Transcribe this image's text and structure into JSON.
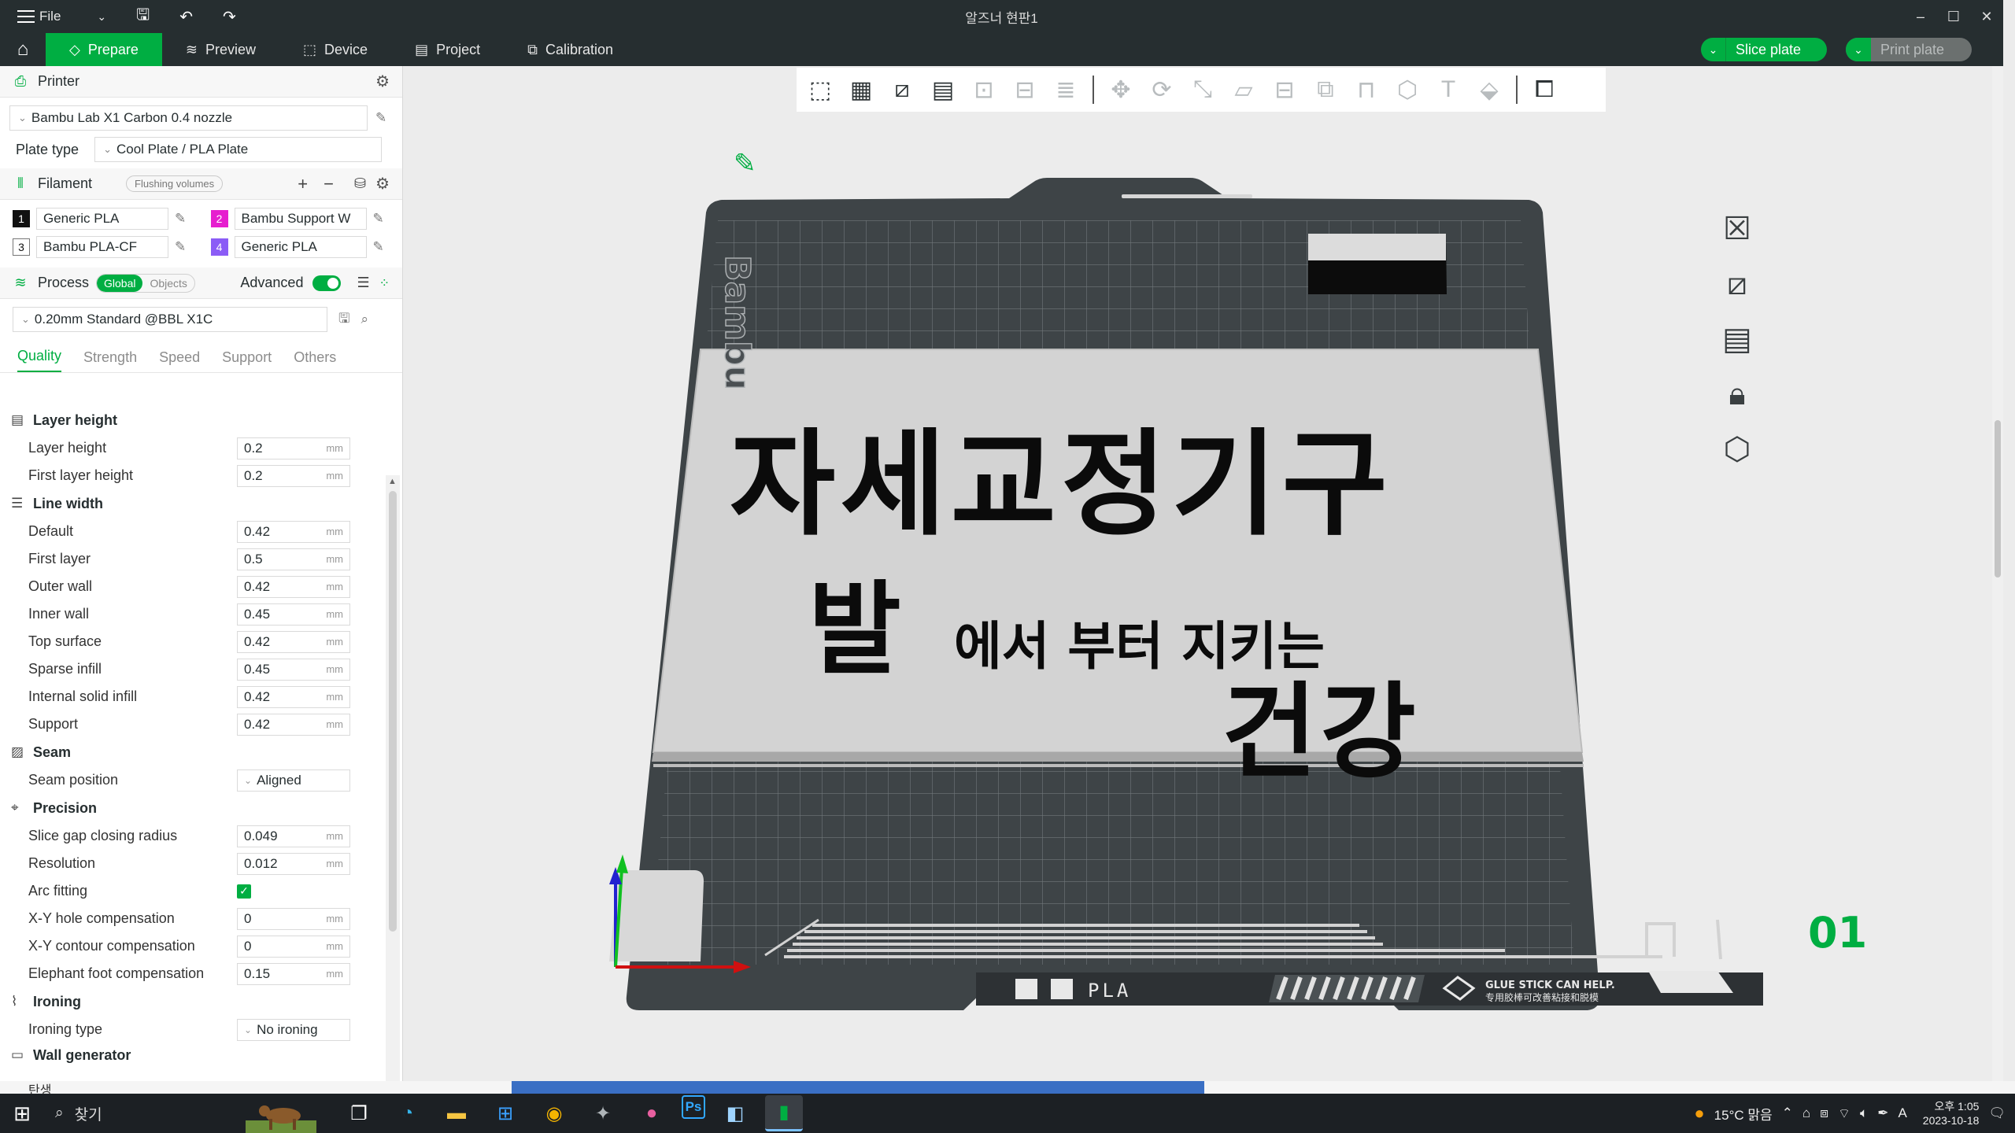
{
  "window": {
    "title": "알즈너 현판1",
    "file_label": "File"
  },
  "tabs": [
    {
      "label": "Prepare",
      "active": true
    },
    {
      "label": "Preview",
      "active": false
    },
    {
      "label": "Device",
      "active": false
    },
    {
      "label": "Project",
      "active": false
    },
    {
      "label": "Calibration",
      "active": false
    }
  ],
  "actions": {
    "slice_label": "Slice plate",
    "print_label": "Print plate"
  },
  "printer": {
    "section_label": "Printer",
    "preset": "Bambu Lab X1 Carbon 0.4 nozzle",
    "plate_type_label": "Plate type",
    "plate_type": "Cool Plate / PLA Plate"
  },
  "filament": {
    "section_label": "Filament",
    "flushing_label": "Flushing volumes",
    "items": [
      {
        "num": "1",
        "name": "Generic PLA",
        "color": "#111111",
        "text_color": "#ffffff"
      },
      {
        "num": "2",
        "name": "Bambu Support W",
        "color": "#e61ecf",
        "text_color": "#ffffff"
      },
      {
        "num": "3",
        "name": "Bambu PLA-CF",
        "color": "#ffffff",
        "text_color": "#111111"
      },
      {
        "num": "4",
        "name": "Generic PLA",
        "color": "#8b5cf6",
        "text_color": "#ffffff"
      }
    ]
  },
  "process": {
    "section_label": "Process",
    "global_label": "Global",
    "objects_label": "Objects",
    "advanced_label": "Advanced",
    "preset": "0.20mm Standard @BBL X1C",
    "subtabs": [
      "Quality",
      "Strength",
      "Speed",
      "Support",
      "Others"
    ]
  },
  "params": {
    "layer_height": {
      "title": "Layer height",
      "rows": [
        {
          "label": "Layer height",
          "value": "0.2",
          "unit": "mm"
        },
        {
          "label": "First layer height",
          "value": "0.2",
          "unit": "mm"
        }
      ]
    },
    "line_width": {
      "title": "Line width",
      "rows": [
        {
          "label": "Default",
          "value": "0.42",
          "unit": "mm"
        },
        {
          "label": "First layer",
          "value": "0.5",
          "unit": "mm"
        },
        {
          "label": "Outer wall",
          "value": "0.42",
          "unit": "mm"
        },
        {
          "label": "Inner wall",
          "value": "0.45",
          "unit": "mm"
        },
        {
          "label": "Top surface",
          "value": "0.42",
          "unit": "mm"
        },
        {
          "label": "Sparse infill",
          "value": "0.45",
          "unit": "mm"
        },
        {
          "label": "Internal solid infill",
          "value": "0.42",
          "unit": "mm"
        },
        {
          "label": "Support",
          "value": "0.42",
          "unit": "mm"
        }
      ]
    },
    "seam": {
      "title": "Seam",
      "position_label": "Seam position",
      "position_value": "Aligned"
    },
    "precision": {
      "title": "Precision",
      "rows": [
        {
          "label": "Slice gap closing radius",
          "value": "0.049",
          "unit": "mm"
        },
        {
          "label": "Resolution",
          "value": "0.012",
          "unit": "mm"
        }
      ],
      "arc_label": "Arc fitting",
      "rows2": [
        {
          "label": "X-Y hole compensation",
          "value": "0",
          "unit": "mm"
        },
        {
          "label": "X-Y contour compensation",
          "value": "0",
          "unit": "mm"
        },
        {
          "label": "Elephant foot compensation",
          "value": "0.15",
          "unit": "mm"
        }
      ]
    },
    "ironing": {
      "title": "Ironing",
      "type_label": "Ironing type",
      "type_value": "No ironing"
    },
    "wall_generator": {
      "title": "Wall generator"
    }
  },
  "model": {
    "line1": "자세교정기구",
    "line2_big": "발",
    "line2_small": "에서 부터  지키는",
    "line3": "건강"
  },
  "bed": {
    "brand": "Bambu",
    "label_pla": "PLA",
    "glue_line1": "GLUE STICK CAN HELP.",
    "glue_line2": "专用胶棒可改善粘接和脱模",
    "plate_number": "01"
  },
  "behind": {
    "text": "탄생"
  },
  "taskbar": {
    "search_placeholder": "찾기",
    "weather": "15°C 맑음",
    "time": "오후 1:05",
    "date": "2023-10-18"
  }
}
